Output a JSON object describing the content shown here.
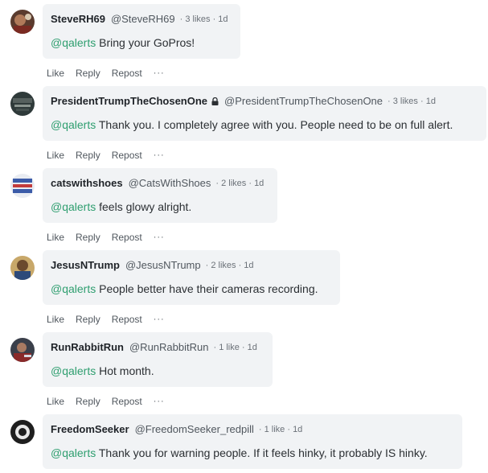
{
  "colors": {
    "mention": "#2e9e6f",
    "bubble_bg": "#f1f3f5"
  },
  "actions": {
    "like": "Like",
    "reply": "Reply",
    "repost": "Repost",
    "more": "···"
  },
  "comments": [
    {
      "name": "SteveRH69",
      "handle": "@SteveRH69",
      "stats": "· 3 likes · 1d",
      "mention": "@qalerts",
      "text": " Bring your GoPros!"
    },
    {
      "name": "PresidentTrumpTheChosenOne",
      "handle": "@PresidentTrumpTheChosenOne",
      "stats": "· 3 likes · 1d",
      "mention": "@qalerts",
      "text": " Thank you. I completely agree with you. People need to be on full alert.",
      "locked": true
    },
    {
      "name": "catswithshoes",
      "handle": "@CatsWithShoes",
      "stats": "· 2 likes · 1d",
      "mention": "@qalerts",
      "text": " feels glowy alright."
    },
    {
      "name": "JesusNTrump",
      "handle": "@JesusNTrump",
      "stats": "· 2 likes · 1d",
      "mention": "@qalerts",
      "text": " People better have their cameras recording."
    },
    {
      "name": "RunRabbitRun",
      "handle": "@RunRabbitRun",
      "stats": "· 1 like · 1d",
      "mention": "@qalerts",
      "text": " Hot month."
    },
    {
      "name": "FreedomSeeker",
      "handle": "@FreedomSeeker_redpill",
      "stats": "· 1 like · 1d",
      "mention": "@qalerts",
      "text": " Thank you for warning people. If it feels hinky, it probably IS hinky."
    }
  ]
}
